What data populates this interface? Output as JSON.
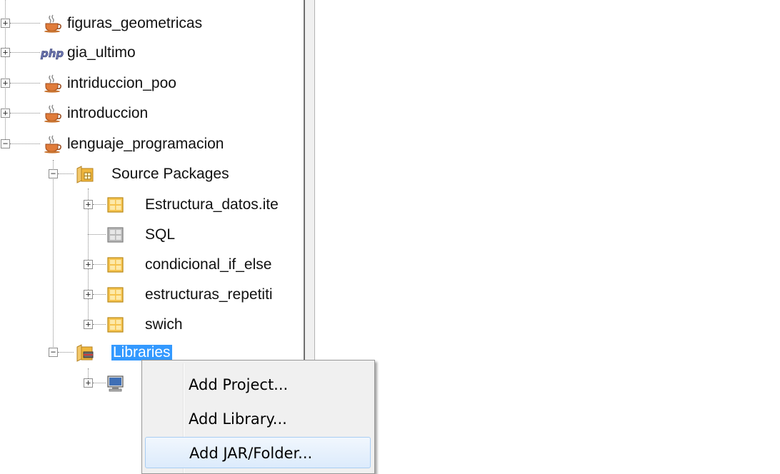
{
  "tree": {
    "items": [
      {
        "label": "figuras_geometricas",
        "icon": "java-cup-icon",
        "expander": "+"
      },
      {
        "label": "gia_ultimo",
        "icon": "php-icon",
        "expander": "+"
      },
      {
        "label": "intriduccion_poo",
        "icon": "java-cup-icon",
        "expander": "+"
      },
      {
        "label": "introduccion",
        "icon": "java-cup-icon",
        "expander": "+"
      },
      {
        "label": "lenguaje_programacion",
        "icon": "java-cup-icon",
        "expander": "−"
      },
      {
        "label": "Source Packages",
        "icon": "source-packages-icon",
        "expander": "−"
      },
      {
        "label": "Estructura_datos.ite",
        "icon": "package-icon",
        "expander": "+"
      },
      {
        "label": "SQL",
        "icon": "empty-package-icon",
        "expander": ""
      },
      {
        "label": "condicional_if_else",
        "icon": "package-icon",
        "expander": "+"
      },
      {
        "label": "estructuras_repetiti",
        "icon": "package-icon",
        "expander": "+"
      },
      {
        "label": "swich",
        "icon": "package-icon",
        "expander": "+"
      },
      {
        "label": "Libraries",
        "icon": "libraries-icon",
        "expander": "−",
        "selected": true
      },
      {
        "label": "",
        "icon": "jdk-icon",
        "expander": "+"
      }
    ]
  },
  "context_menu": {
    "items": [
      {
        "label": "Add Project..."
      },
      {
        "label": "Add Library..."
      },
      {
        "label": "Add JAR/Folder...",
        "hovered": true
      }
    ]
  },
  "colors": {
    "selection": "#3399ff",
    "menu_background": "#f0f0f0",
    "menu_hover_border": "#a8cdf3"
  }
}
